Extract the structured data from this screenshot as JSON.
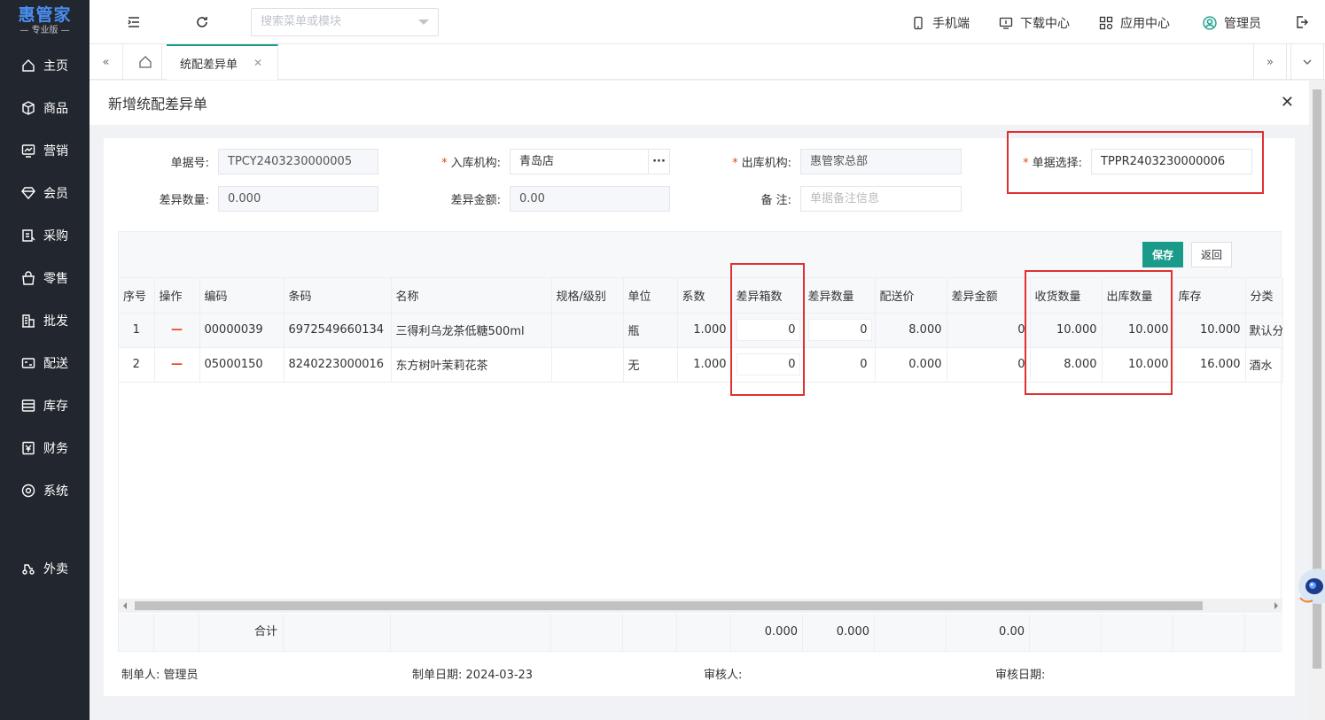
{
  "logo": {
    "name": "惠管家",
    "edition": "— 专业版 —"
  },
  "nav": [
    {
      "label": "主页",
      "icon": "home-icon"
    },
    {
      "label": "商品",
      "icon": "box-icon"
    },
    {
      "label": "营销",
      "icon": "chart-icon"
    },
    {
      "label": "会员",
      "icon": "diamond-icon"
    },
    {
      "label": "采购",
      "icon": "purchase-icon"
    },
    {
      "label": "零售",
      "icon": "bag-icon"
    },
    {
      "label": "批发",
      "icon": "building-icon"
    },
    {
      "label": "配送",
      "icon": "delivery-icon"
    },
    {
      "label": "库存",
      "icon": "inventory-icon"
    },
    {
      "label": "财务",
      "icon": "finance-icon"
    },
    {
      "label": "系统",
      "icon": "settings-icon"
    },
    {
      "label": "外卖",
      "icon": "takeout-icon"
    }
  ],
  "topbar": {
    "search_placeholder": "搜索菜单或模块",
    "mobile": "手机端",
    "download": "下载中心",
    "apps": "应用中心",
    "user": "管理员"
  },
  "tabs": {
    "active": "统配差异单"
  },
  "dialog": {
    "title": "新增统配差异单"
  },
  "form": {
    "doc_no_label": "单据号:",
    "doc_no": "TPCY2403230000005",
    "in_org_label": "入库机构:",
    "in_org": "青岛店",
    "out_org_label": "出库机构:",
    "out_org": "惠管家总部",
    "doc_select_label": "单据选择:",
    "doc_select": "TPPR2403230000006",
    "diff_qty_label": "差异数量:",
    "diff_qty": "0.000",
    "diff_amt_label": "差异金额:",
    "diff_amt": "0.00",
    "remark_label": "备 注:",
    "remark_placeholder": "单据备注信息"
  },
  "buttons": {
    "save": "保存",
    "back": "返回"
  },
  "table": {
    "headers": [
      "序号",
      "操作",
      "编码",
      "条码",
      "名称",
      "规格/级别",
      "单位",
      "系数",
      "差异箱数",
      "差异数量",
      "配送价",
      "差异金额",
      "收货数量",
      "出库数量",
      "库存",
      "分类"
    ],
    "rows": [
      {
        "no": "1",
        "op": "—",
        "code": "00000039",
        "barcode": "6972549660134",
        "name": "三得利乌龙茶低糖500ml",
        "spec": "",
        "unit": "瓶",
        "factor": "1.000",
        "diff_box": "0",
        "diff_qty": "0",
        "price": "8.000",
        "diff_amt": "0",
        "recv": "10.000",
        "out": "10.000",
        "stock": "10.000",
        "cat": "默认分"
      },
      {
        "no": "2",
        "op": "—",
        "code": "05000150",
        "barcode": "8240223000016",
        "name": "东方树叶茉莉花茶",
        "spec": "",
        "unit": "无",
        "factor": "1.000",
        "diff_box": "0",
        "diff_qty": "0",
        "price": "0.000",
        "diff_amt": "0",
        "recv": "8.000",
        "out": "10.000",
        "stock": "16.000",
        "cat": "酒水"
      }
    ],
    "footer": {
      "label": "合计",
      "diff_box": "0.000",
      "diff_qty": "0.000",
      "diff_amt": "0.00"
    }
  },
  "meta": {
    "creator_label": "制单人:",
    "creator": "管理员",
    "date_label": "制单日期:",
    "date": "2024-03-23",
    "reviewer_label": "审核人:",
    "reviewer": "",
    "review_date_label": "审核日期:",
    "review_date": ""
  },
  "colors": {
    "accent": "#1a9b8a",
    "sidebar": "#22262e",
    "highlight": "#e03030",
    "required": "#e6461c"
  }
}
